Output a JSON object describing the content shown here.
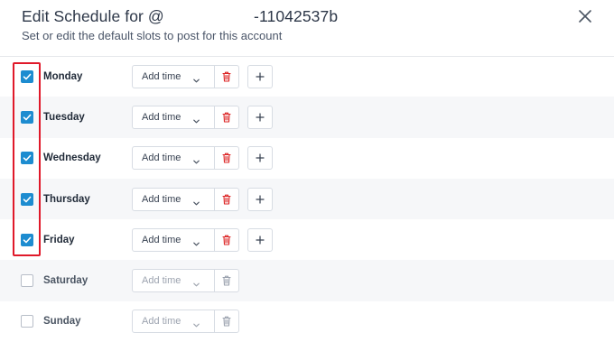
{
  "header": {
    "title": "Edit Schedule for @                    -11042537b",
    "subtitle": "Set or edit the default slots to post for this account"
  },
  "colors": {
    "accent": "#1d8cd0",
    "danger": "#dc2626",
    "highlight": "#e0192a",
    "row_alt_bg": "#f6f7f9"
  },
  "icons": {
    "close": "close-icon",
    "chevron": "chevron-down-icon",
    "delete": "trash-icon",
    "add": "plus-icon",
    "check": "check-icon"
  },
  "days": [
    {
      "label": "Monday",
      "checked": true,
      "time_label": "Add time"
    },
    {
      "label": "Tuesday",
      "checked": true,
      "time_label": "Add time"
    },
    {
      "label": "Wednesday",
      "checked": true,
      "time_label": "Add time"
    },
    {
      "label": "Thursday",
      "checked": true,
      "time_label": "Add time"
    },
    {
      "label": "Friday",
      "checked": true,
      "time_label": "Add time"
    },
    {
      "label": "Saturday",
      "checked": false,
      "time_label": "Add time"
    },
    {
      "label": "Sunday",
      "checked": false,
      "time_label": "Add time"
    }
  ]
}
